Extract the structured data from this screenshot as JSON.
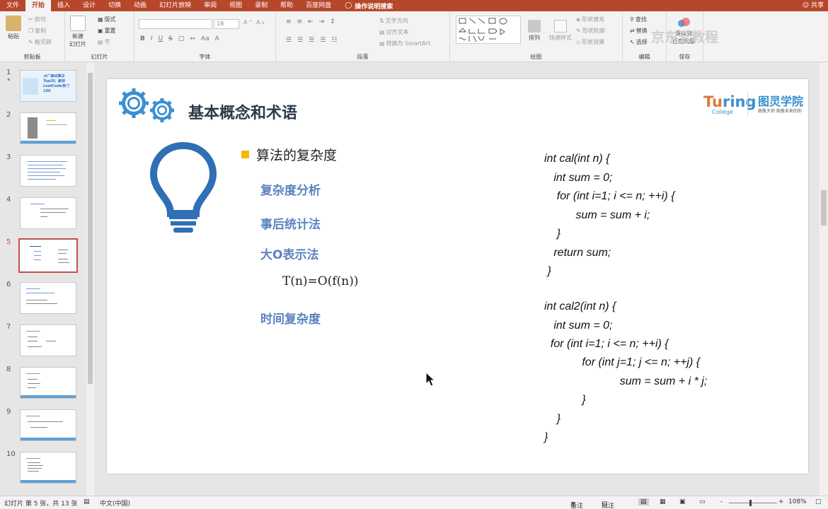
{
  "tabs": [
    "文件",
    "开始",
    "插入",
    "设计",
    "切换",
    "动画",
    "幻灯片放映",
    "审阅",
    "视图",
    "录制",
    "帮助",
    "百度网盘"
  ],
  "active_tab": "开始",
  "tell_me": "操作说明搜索",
  "share": "共享",
  "ribbon": {
    "clipboard": {
      "paste": "粘贴",
      "cut": "剪切",
      "copy": "复制",
      "format_painter": "格式刷",
      "label": "剪贴板"
    },
    "slides": {
      "new_slide": "新建\n幻灯片",
      "layout": "版式",
      "reset": "重置",
      "section": "节",
      "label": "幻灯片"
    },
    "font": {
      "font_size": "18",
      "bold": "B",
      "italic": "I",
      "underline": "U",
      "strike": "S",
      "label": "字体"
    },
    "paragraph": {
      "text_direction": "文字方向",
      "align_text": "对齐文本",
      "smartart": "转换为 SmartArt",
      "label": "段落"
    },
    "drawing": {
      "arrange": "排列",
      "quick_styles": "快速样式",
      "shape_fill": "形状填充",
      "shape_outline": "形状轮廓",
      "shape_effects": "形状效果",
      "label": "绘图"
    },
    "editing": {
      "find": "查找",
      "replace": "替换",
      "select": "选择",
      "label": "编辑"
    },
    "save": {
      "save_to": "保存到\n百度网盘",
      "label": "保存"
    },
    "watermark": "京东云教程"
  },
  "thumbnails": [
    {
      "num": "1",
      "star": "*",
      "text": "大厂面试算法Top20, 复刻LeetCode热门100"
    },
    {
      "num": "2"
    },
    {
      "num": "3"
    },
    {
      "num": "4"
    },
    {
      "num": "5",
      "selected": true
    },
    {
      "num": "6"
    },
    {
      "num": "7"
    },
    {
      "num": "8"
    },
    {
      "num": "9"
    },
    {
      "num": "10"
    }
  ],
  "slide": {
    "title": "基本概念和术语",
    "bullet": "算法的复杂度",
    "subs": [
      "复杂度分析",
      "事后统计法",
      "大O表示法",
      "时间复杂度"
    ],
    "formula": "T(n)=O(f(n))",
    "code1": [
      "int cal(int n) {",
      "   int sum = 0;",
      "    for (int i=1; i <= n; ++i) {",
      "          sum = sum + i;",
      "    }",
      "   return sum;",
      " }"
    ],
    "code2": [
      "int cal2(int n) {",
      "   int sum = 0;",
      "  for (int i=1; i <= n; ++i) {",
      "            for (int j=1; j <= n; ++j) {",
      "                        sum = sum + i * j;",
      "            }",
      "    }",
      "}"
    ],
    "logo": {
      "brand_a": "Tu",
      "brand_b": "ring",
      "college": "College",
      "cn": "图灵学院",
      "slogan": "致敬大师 致敬未来的你"
    }
  },
  "status": {
    "slide_info": "幻灯片 第 5 张，共 13 张",
    "language": "中文(中国)",
    "notes": "备注",
    "comments": "批注",
    "zoom": "108%"
  },
  "colors": {
    "accent": "#b7472a",
    "sub_heading": "#5b82c0",
    "bullet": "#f5b800",
    "gear": "#3a8fd0"
  }
}
